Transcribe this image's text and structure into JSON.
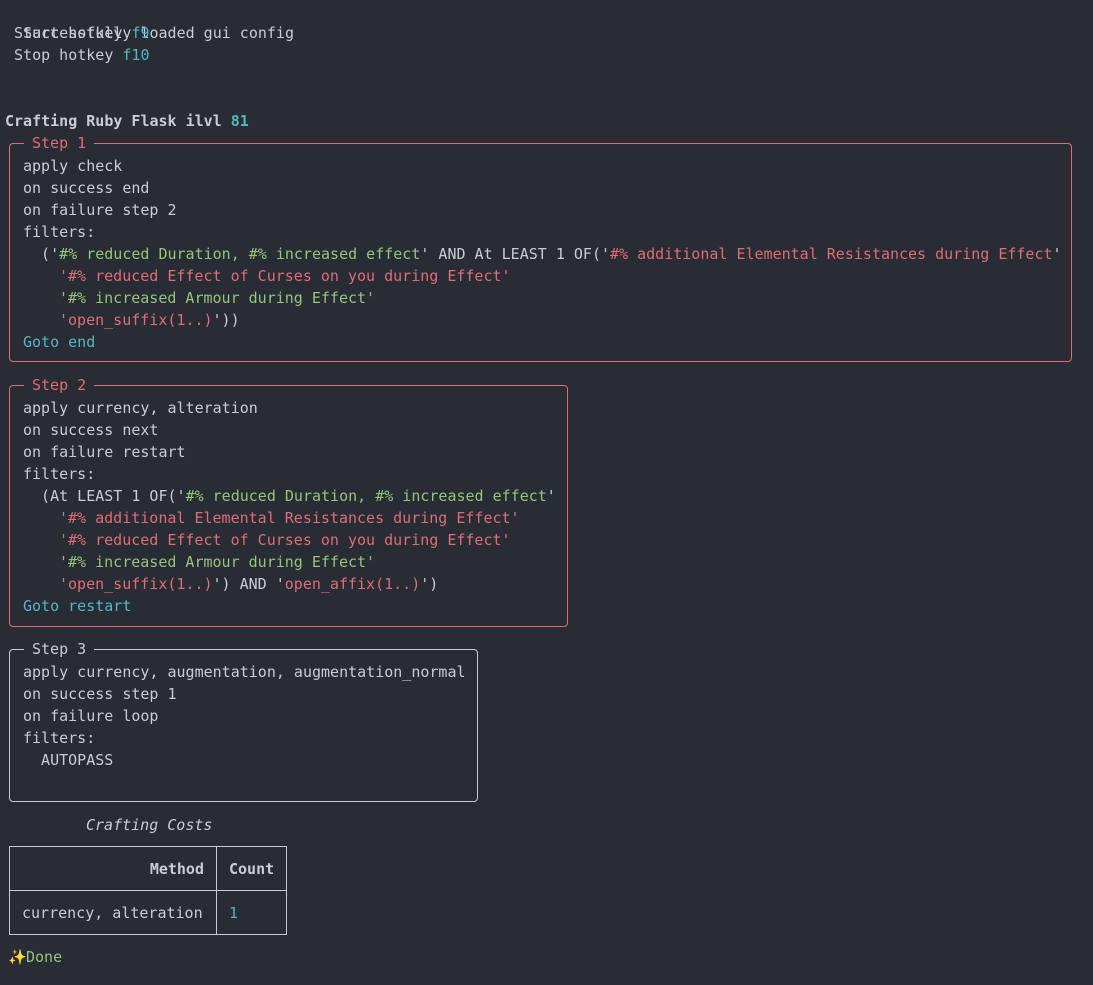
{
  "header": {
    "loaded": "Successfully loaded gui config",
    "start_label": " Start hotkey ",
    "start_key": "f9",
    "stop_label": " Stop hotkey ",
    "stop_key": "f10"
  },
  "crafting": {
    "title": "Crafting Ruby Flask ilvl ",
    "ilvl": "81"
  },
  "steps": [
    {
      "title": "Step 1",
      "apply": "apply check",
      "success": "on success end",
      "failure": "on failure step 2",
      "filters_label": "filters:",
      "f1a": "  ('",
      "f1b": "#% reduced Duration, #% increased effect",
      "f1c": "' AND At LEAST 1 OF('",
      "f1d": "#% additional Elemental Resistances during Effect",
      "f1e": "'",
      "f2": "#% reduced Effect of Curses on you during Effect",
      "f3": "#% increased Armour during Effect",
      "f4a": "open_suffix(1..)",
      "f4b": "'))",
      "goto": "Goto end"
    },
    {
      "title": "Step 2",
      "apply": "apply currency, alteration",
      "success": "on success next",
      "failure": "on failure restart",
      "filters_label": "filters:",
      "f1a": "  (At LEAST 1 OF('",
      "f1b": "#% reduced Duration, #% increased effect",
      "f1c": "'",
      "f2": "#% additional Elemental Resistances during Effect",
      "f3": "#% reduced Effect of Curses on you during Effect",
      "f4": "#% increased Armour during Effect",
      "f5a": "open_suffix(1..)",
      "f5b": "') AND '",
      "f5c": "open_affix(1..)",
      "f5d": "')",
      "goto": "Goto restart"
    },
    {
      "title": "Step 3",
      "apply": "apply currency, augmentation, augmentation_normal",
      "success": "on success step 1",
      "failure": "on failure loop",
      "filters_label": "filters:",
      "f1": "  AUTOPASS"
    }
  ],
  "costs": {
    "caption": "Crafting Costs",
    "headers": [
      "Method",
      "Count"
    ],
    "rows": [
      {
        "method": "currency, alteration",
        "count": "1"
      }
    ]
  },
  "done": {
    "icon": "✨",
    "label": "Done"
  },
  "colors": {
    "background": "#282c34",
    "text": "#c8ccd4",
    "red": "#e06c75",
    "green": "#98c379",
    "cyan": "#56b6c2"
  }
}
